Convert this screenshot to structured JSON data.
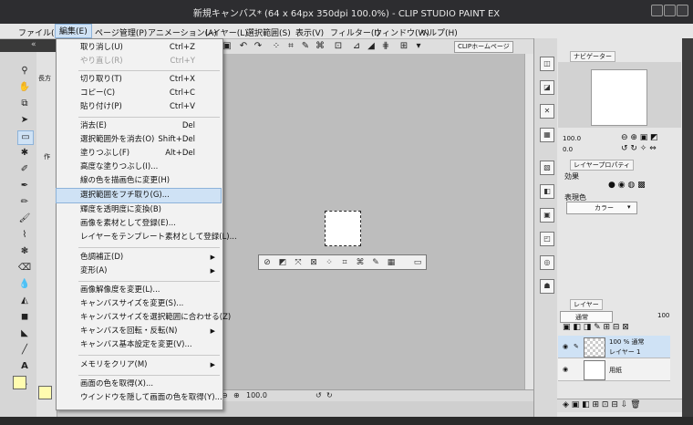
{
  "window": {
    "title": "新規キャンバス* (64 x 64px 350dpi 100.0%) - CLIP STUDIO PAINT EX"
  },
  "menubar": {
    "items": [
      "ファイル(F)",
      "編集(E)",
      "ページ管理(P)",
      "アニメーション(A)",
      "レイヤー(L)",
      "選択範囲(S)",
      "表示(V)",
      "フィルター(I)",
      "ウィンドウ(W)",
      "ヘルプ(H)"
    ]
  },
  "edit_menu": {
    "items": [
      {
        "label": "取り消し(U)",
        "shortcut": "Ctrl+Z"
      },
      {
        "label": "やり直し(R)",
        "shortcut": "Ctrl+Y",
        "disabled": true
      },
      {
        "label": "切り取り(T)",
        "shortcut": "Ctrl+X"
      },
      {
        "label": "コピー(C)",
        "shortcut": "Ctrl+C"
      },
      {
        "label": "貼り付け(P)",
        "shortcut": "Ctrl+V"
      },
      {
        "label": "消去(E)",
        "shortcut": "Del"
      },
      {
        "label": "選択範囲外を消去(O)",
        "shortcut": "Shift+Del"
      },
      {
        "label": "塗りつぶし(F)",
        "shortcut": "Alt+Del"
      },
      {
        "label": "高度な塗りつぶし(I)..."
      },
      {
        "label": "線の色を描画色に変更(H)"
      },
      {
        "label": "選択範囲をフチ取り(G)...",
        "highlighted": true
      },
      {
        "label": "輝度を透明度に変換(B)"
      },
      {
        "label": "画像を素材として登録(E)..."
      },
      {
        "label": "レイヤーをテンプレート素材として登録(L)..."
      },
      {
        "label": "色調補正(D)",
        "submenu": true
      },
      {
        "label": "変形(A)",
        "submenu": true
      },
      {
        "label": "画像解像度を変更(L)..."
      },
      {
        "label": "キャンバスサイズを変更(S)..."
      },
      {
        "label": "キャンバスサイズを選択範囲に合わせる(Z)"
      },
      {
        "label": "キャンバスを回転・反転(N)",
        "submenu": true
      },
      {
        "label": "キャンバス基本設定を変更(V)..."
      },
      {
        "label": "メモリをクリア(M)",
        "submenu": true
      },
      {
        "label": "画面の色を取得(X)..."
      },
      {
        "label": "ウインドウを隠して画面の色を取得(Y)..."
      }
    ]
  },
  "command_bar": {
    "clip_home": "CLIPホームページ"
  },
  "navigator": {
    "tab": "ナビゲーター",
    "zoom": "100.0",
    "angle": "0.0"
  },
  "layer_property": {
    "tab": "レイヤープロパティ",
    "effect": "効果",
    "expression_color": "表現色",
    "color_value": "カラー"
  },
  "layer_panel": {
    "tab": "レイヤー",
    "blend_mode": "通常",
    "opacity": "100",
    "layers": [
      {
        "name": "レイヤー 1",
        "info": "100 % 通常",
        "selected": true
      },
      {
        "name": "用紙",
        "info": ""
      }
    ]
  },
  "tool_panel": {
    "tab_label": "長方",
    "sub_label": "作"
  },
  "bottom_bar": {
    "zoom": "100.0"
  },
  "colors": {
    "highlight": "#cfe2f5",
    "titlebar": "#2d2d30",
    "main_color": "#fffcb0",
    "sub_color": "#ffffff"
  }
}
